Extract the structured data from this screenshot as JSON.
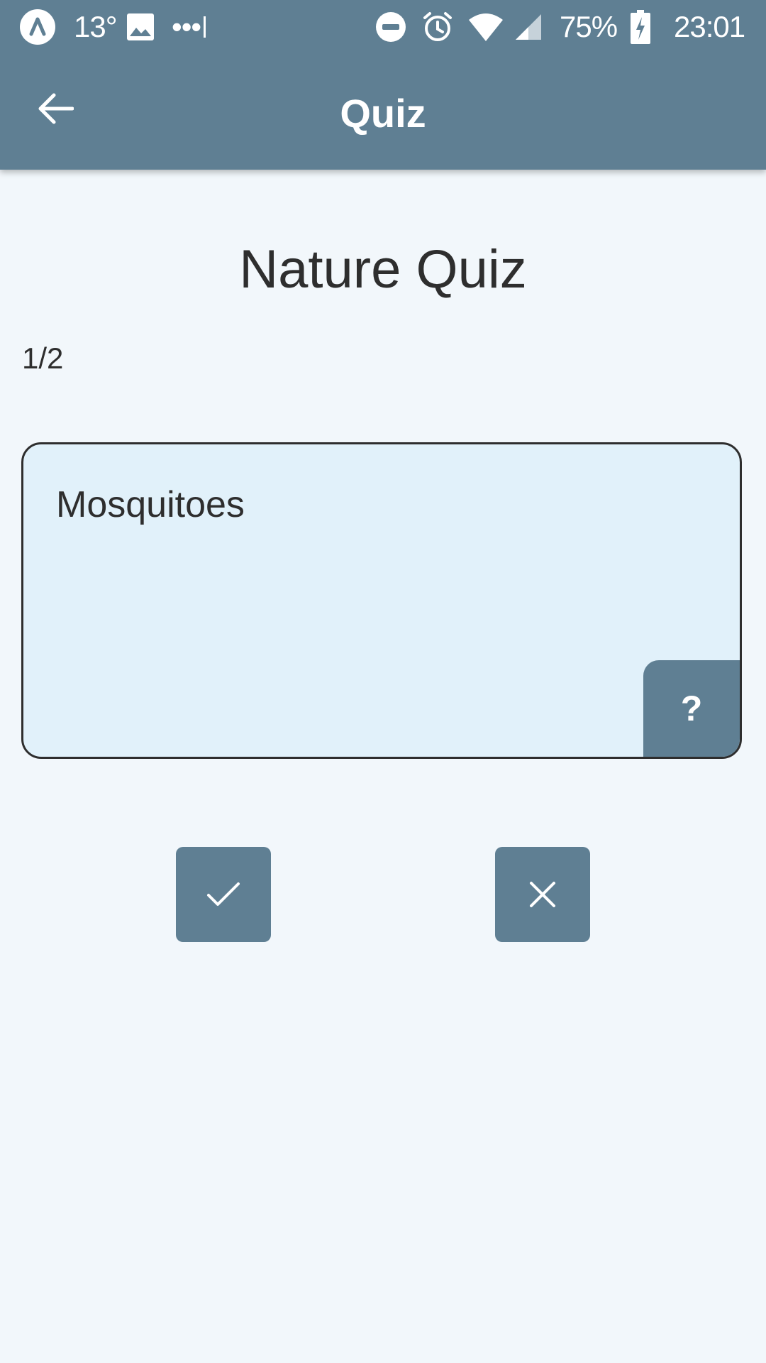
{
  "status_bar": {
    "temperature": "13°",
    "more": "•••",
    "battery_percent": "75%",
    "time": "23:01",
    "icons": [
      "app-logo-icon",
      "image-icon",
      "dnd-icon",
      "alarm-icon",
      "wifi-icon",
      "cell-signal-icon",
      "battery-charging-icon"
    ]
  },
  "app_bar": {
    "title": "Quiz",
    "back_icon": "arrow-back-icon"
  },
  "quiz": {
    "title": "Nature Quiz",
    "progress": "1/2",
    "card_text": "Mosquitoes",
    "hint_label": "?"
  },
  "actions": {
    "correct_icon": "check-icon",
    "wrong_icon": "close-icon"
  },
  "colors": {
    "primary": "#5f7f93",
    "background": "#f2f7fb",
    "card": "#e1f1fa",
    "text": "#2e2e2e"
  }
}
